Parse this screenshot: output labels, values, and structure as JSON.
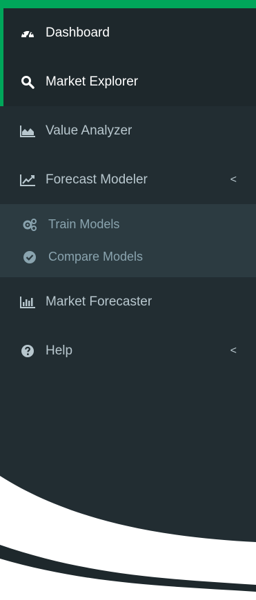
{
  "colors": {
    "accent": "#00a65a",
    "sidebar_bg": "#222d32",
    "active_bg": "#1e282c",
    "submenu_bg": "#2c3b41",
    "text": "#b8c7ce"
  },
  "menu": {
    "dashboard": {
      "label": "Dashboard",
      "icon": "dashboard-gauge-icon"
    },
    "market_explorer": {
      "label": "Market Explorer",
      "icon": "search-icon"
    },
    "value_analyzer": {
      "label": "Value Analyzer",
      "icon": "area-chart-icon"
    },
    "forecast_modeler": {
      "label": "Forecast Modeler",
      "icon": "line-chart-icon",
      "chevron": "<",
      "children": [
        {
          "label": "Train Models",
          "icon": "gears-icon"
        },
        {
          "label": "Compare Models",
          "icon": "check-circle-icon"
        }
      ]
    },
    "market_forecaster": {
      "label": "Market Forecaster",
      "icon": "bar-chart-icon"
    },
    "help": {
      "label": "Help",
      "icon": "question-circle-icon",
      "chevron": "<"
    }
  }
}
